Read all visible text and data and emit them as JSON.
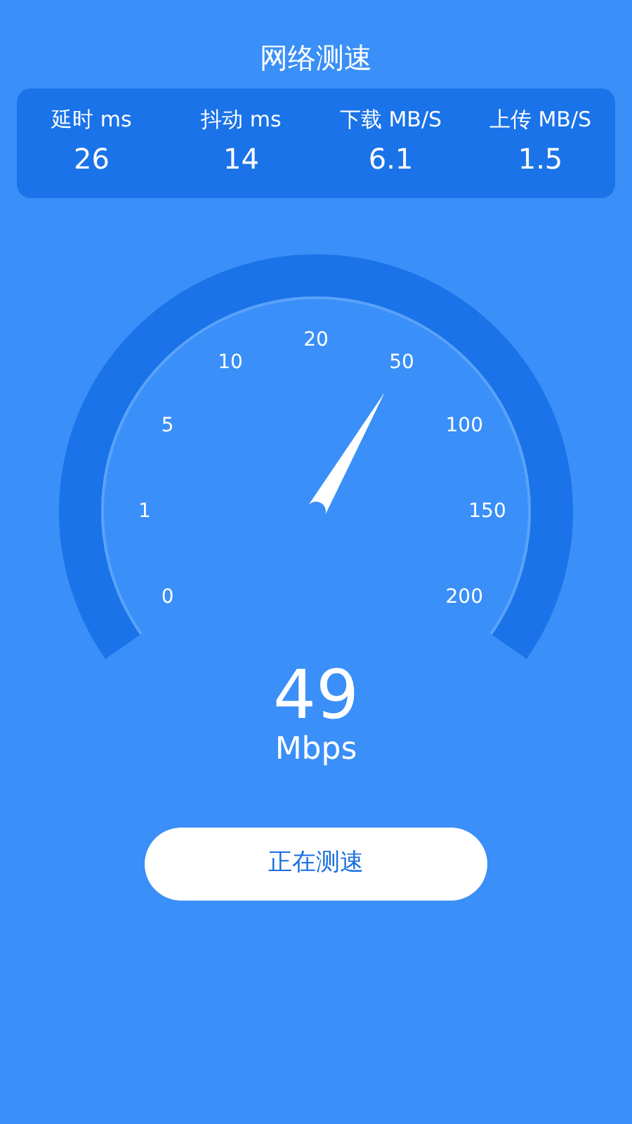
{
  "title": "网络测速",
  "stats": [
    {
      "label": "延时 ms",
      "value": "26"
    },
    {
      "label": "抖动 ms",
      "value": "14"
    },
    {
      "label": "下载 MB/S",
      "value": "6.1"
    },
    {
      "label": "上传 MB/S",
      "value": "1.5"
    }
  ],
  "gauge": {
    "ticks": [
      "0",
      "1",
      "5",
      "10",
      "20",
      "50",
      "100",
      "150",
      "200"
    ],
    "reading": "49",
    "unit": "Mbps"
  },
  "button": "正在测速"
}
